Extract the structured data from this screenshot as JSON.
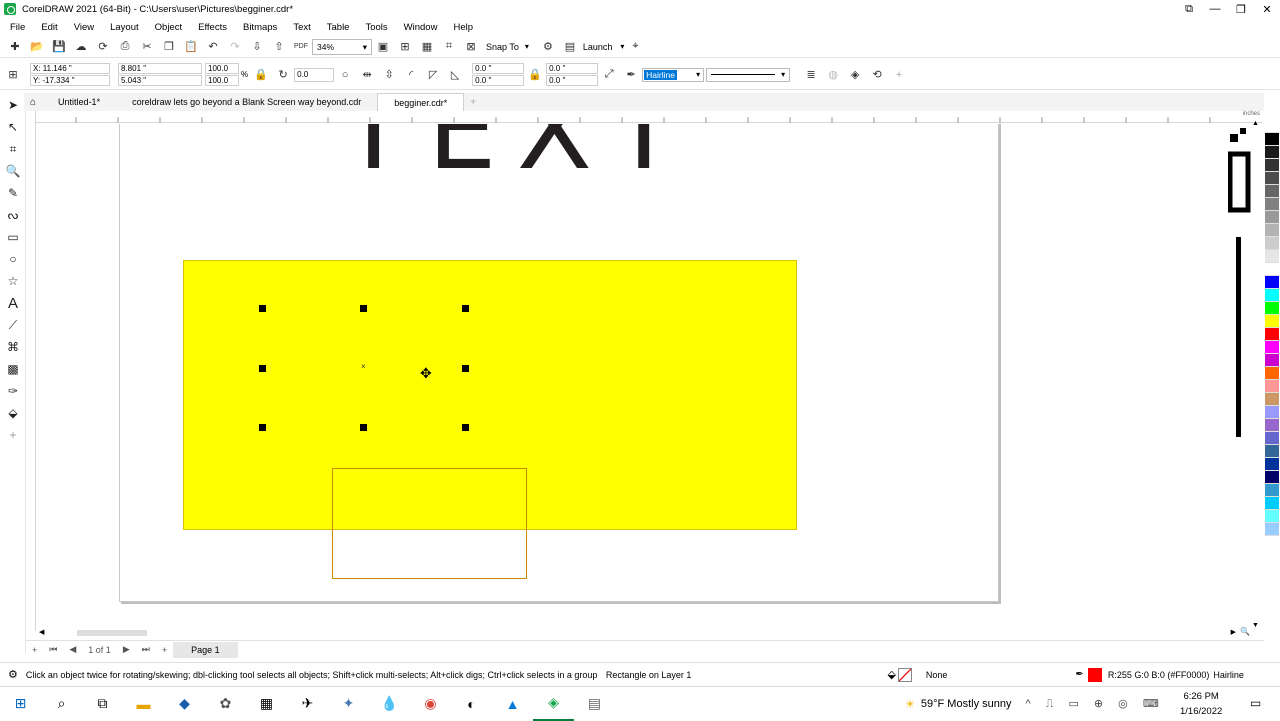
{
  "window": {
    "title": "CorelDRAW 2021 (64-Bit) - C:\\Users\\user\\Pictures\\begginer.cdr*"
  },
  "menu": [
    "File",
    "Edit",
    "View",
    "Layout",
    "Object",
    "Effects",
    "Bitmaps",
    "Text",
    "Table",
    "Tools",
    "Window",
    "Help"
  ],
  "toolbar": {
    "zoom": "34%",
    "snap_to": "Snap To",
    "launch": "Launch"
  },
  "property_bar": {
    "x": "X: 11.146 \"",
    "y": "Y: -17.334 \"",
    "width": "8.801 \"",
    "height": "5.043 \"",
    "scale_w": "100.0",
    "scale_h": "100.0",
    "percent": "%",
    "rotation": "0.0",
    "corner1": "0.0 \"",
    "corner2": "0.0 \"",
    "corner3": "0.0 \"",
    "corner4": "0.0 \"",
    "outline_width": "Hairline"
  },
  "tabs": [
    {
      "label": "Untitled-1*",
      "active": false
    },
    {
      "label": "coreldraw lets go beyond a Blank Screen way beyond.cdr",
      "active": false
    },
    {
      "label": "begginer.cdr*",
      "active": true
    }
  ],
  "rulers": {
    "unit": "inches"
  },
  "canvas": {
    "big_text": "TEXT"
  },
  "page_nav": {
    "counter": "1 of 1",
    "page_tab": "Page 1"
  },
  "status": {
    "hint": "Click an object twice for rotating/skewing; dbl-clicking tool selects all objects; Shift+click multi-selects; Alt+click digs; Ctrl+click selects in a group",
    "object_info": "Rectangle on Layer 1",
    "fill": "None",
    "outline_color": "R:255 G:0 B:0 (#FF0000)",
    "outline_width": "Hairline"
  },
  "palette_colors": [
    "#ffffff",
    "#000000",
    "#1a1a1a",
    "#333333",
    "#4d4d4d",
    "#666666",
    "#808080",
    "#999999",
    "#b3b3b3",
    "#cccccc",
    "#e6e6e6",
    "#ffffff",
    "#0000ff",
    "#00ffff",
    "#00ff00",
    "#ffff00",
    "#ff0000",
    "#ff00ff",
    "#cc00cc",
    "#ff6600",
    "#ff9999",
    "#cc9966",
    "#9999ff",
    "#9966cc",
    "#6666cc",
    "#336699",
    "#003399",
    "#000066",
    "#3399cc",
    "#00ccff",
    "#66ffff",
    "#99ccff"
  ],
  "colors": {
    "yellow_fill": "#ffff00",
    "outline_red": "#ff0000",
    "brand_green": "#1aa64a"
  },
  "taskbar": {
    "weather": "59°F  Mostly sunny",
    "time": "6:26 PM",
    "date": "1/16/2022"
  }
}
